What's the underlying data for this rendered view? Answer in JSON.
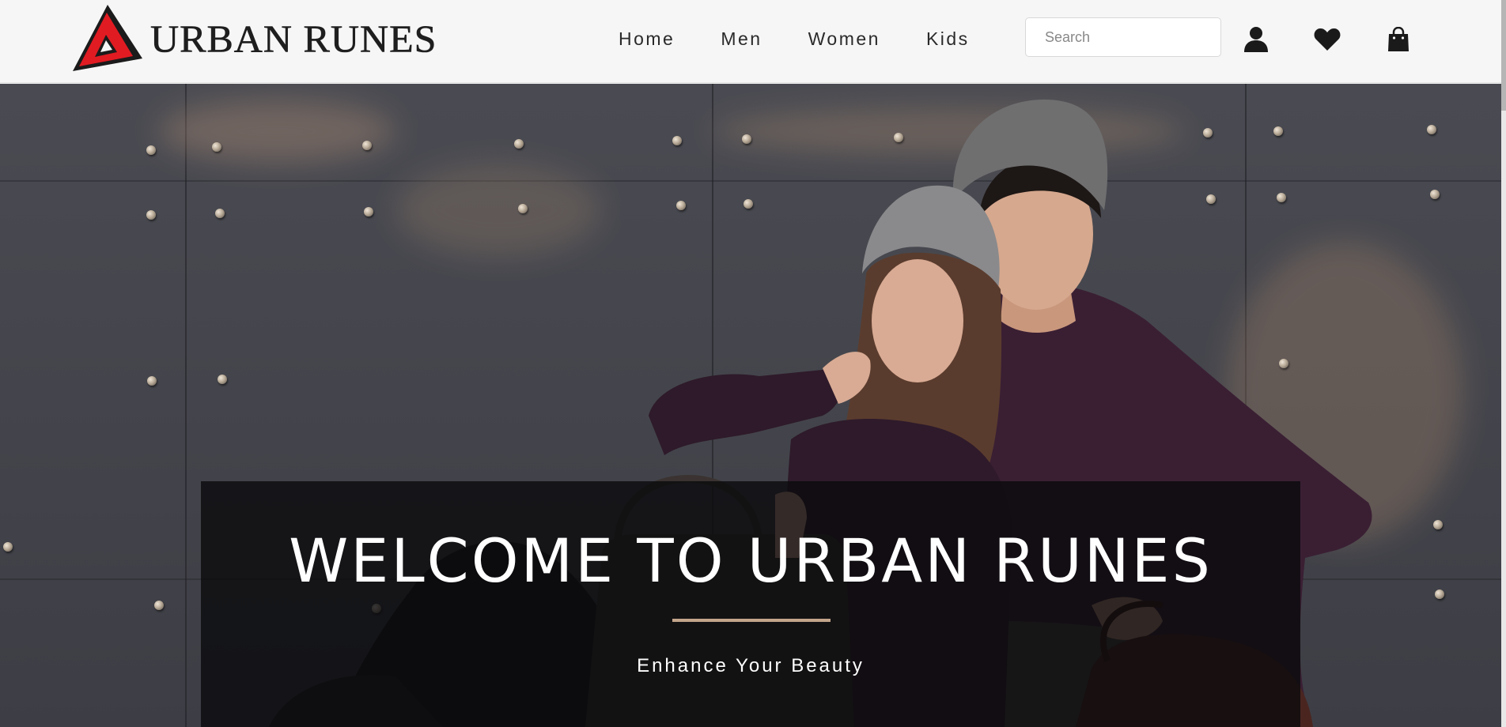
{
  "brand": {
    "name": "URBAN RUNES",
    "logo_colors": {
      "primary": "#e11b22",
      "outline": "#1b1b1b"
    }
  },
  "nav": {
    "items": [
      {
        "label": "Home"
      },
      {
        "label": "Men"
      },
      {
        "label": "Women"
      },
      {
        "label": "Kids"
      }
    ]
  },
  "search": {
    "placeholder": "Search",
    "value": ""
  },
  "header_icons": [
    "user-icon",
    "heart-icon",
    "shopping-bag-icon"
  ],
  "hero": {
    "title": "WELCOME TO URBAN RUNES",
    "subtitle": "Enhance Your Beauty",
    "divider_color": "#c3a58b"
  }
}
